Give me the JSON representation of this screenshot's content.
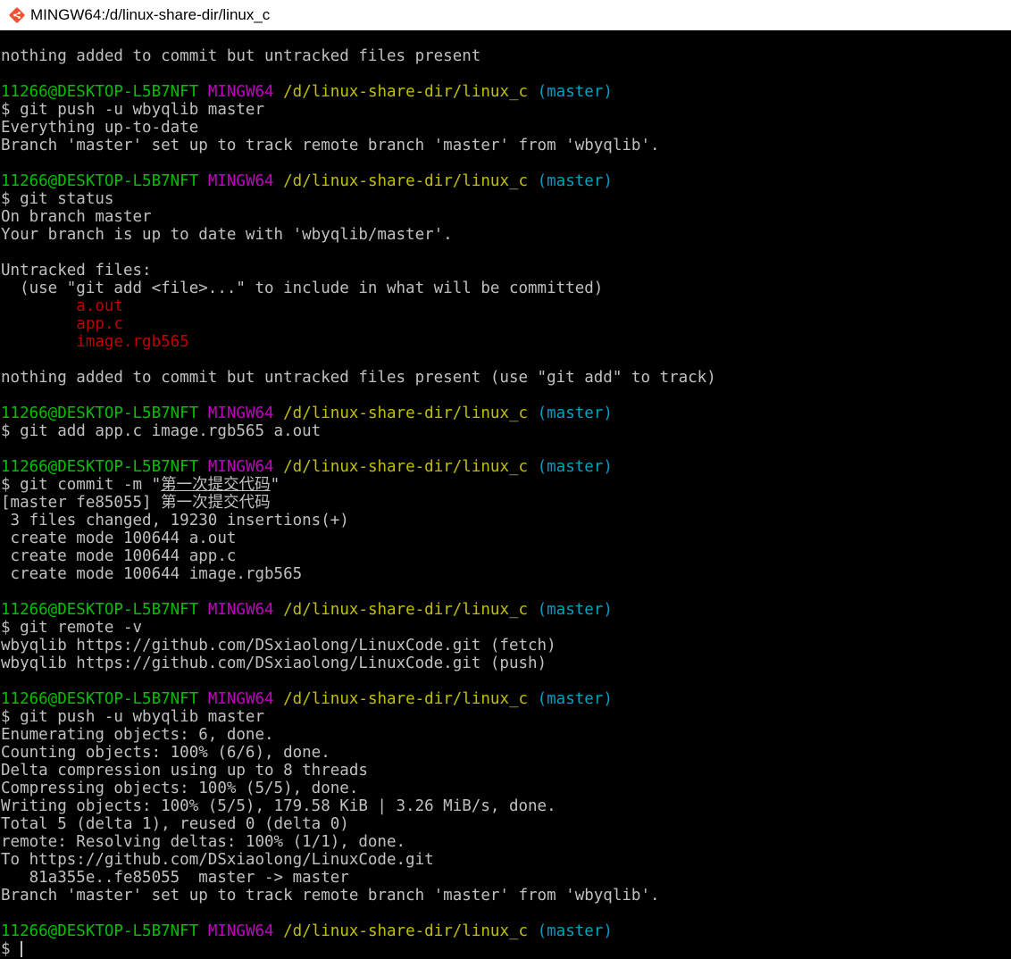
{
  "window": {
    "title": "MINGW64:/d/linux-share-dir/linux_c",
    "icon": "git-bash-icon"
  },
  "colors": {
    "background": "#000000",
    "default_text": "#c0c0c0",
    "user_host": "#00c000",
    "shell_name": "#c000c0",
    "path": "#c0c000",
    "branch": "#00a0c0",
    "untracked_file": "#c00000"
  },
  "terminal": {
    "lines": [
      {
        "segments": [
          {
            "text": "nothing added to commit but untracked files present"
          }
        ]
      },
      {
        "segments": []
      },
      {
        "segments": [
          {
            "text": "11266@DESKTOP-L5B7NFT",
            "color": "green"
          },
          {
            "text": " "
          },
          {
            "text": "MINGW64",
            "color": "magenta"
          },
          {
            "text": " "
          },
          {
            "text": "/d/linux-share-dir/linux_c",
            "color": "yellow"
          },
          {
            "text": " "
          },
          {
            "text": "(master)",
            "color": "cyan"
          }
        ]
      },
      {
        "segments": [
          {
            "text": "$ git push -u wbyqlib master"
          }
        ]
      },
      {
        "segments": [
          {
            "text": "Everything up-to-date"
          }
        ]
      },
      {
        "segments": [
          {
            "text": "Branch 'master' set up to track remote branch 'master' from 'wbyqlib'."
          }
        ]
      },
      {
        "segments": []
      },
      {
        "segments": [
          {
            "text": "11266@DESKTOP-L5B7NFT",
            "color": "green"
          },
          {
            "text": " "
          },
          {
            "text": "MINGW64",
            "color": "magenta"
          },
          {
            "text": " "
          },
          {
            "text": "/d/linux-share-dir/linux_c",
            "color": "yellow"
          },
          {
            "text": " "
          },
          {
            "text": "(master)",
            "color": "cyan"
          }
        ]
      },
      {
        "segments": [
          {
            "text": "$ git status"
          }
        ]
      },
      {
        "segments": [
          {
            "text": "On branch master"
          }
        ]
      },
      {
        "segments": [
          {
            "text": "Your branch is up to date with 'wbyqlib/master'."
          }
        ]
      },
      {
        "segments": []
      },
      {
        "segments": [
          {
            "text": "Untracked files:"
          }
        ]
      },
      {
        "segments": [
          {
            "text": "  (use \"git add <file>...\" to include in what will be committed)"
          }
        ]
      },
      {
        "segments": [
          {
            "text": "        "
          },
          {
            "text": "a.out",
            "color": "red"
          }
        ]
      },
      {
        "segments": [
          {
            "text": "        "
          },
          {
            "text": "app.c",
            "color": "red"
          }
        ]
      },
      {
        "segments": [
          {
            "text": "        "
          },
          {
            "text": "image.rgb565",
            "color": "red"
          }
        ]
      },
      {
        "segments": []
      },
      {
        "segments": [
          {
            "text": "nothing added to commit but untracked files present (use \"git add\" to track)"
          }
        ]
      },
      {
        "segments": []
      },
      {
        "segments": [
          {
            "text": "11266@DESKTOP-L5B7NFT",
            "color": "green"
          },
          {
            "text": " "
          },
          {
            "text": "MINGW64",
            "color": "magenta"
          },
          {
            "text": " "
          },
          {
            "text": "/d/linux-share-dir/linux_c",
            "color": "yellow"
          },
          {
            "text": " "
          },
          {
            "text": "(master)",
            "color": "cyan"
          }
        ]
      },
      {
        "segments": [
          {
            "text": "$ git add app.c image.rgb565 a.out"
          }
        ]
      },
      {
        "segments": []
      },
      {
        "segments": [
          {
            "text": "11266@DESKTOP-L5B7NFT",
            "color": "green"
          },
          {
            "text": " "
          },
          {
            "text": "MINGW64",
            "color": "magenta"
          },
          {
            "text": " "
          },
          {
            "text": "/d/linux-share-dir/linux_c",
            "color": "yellow"
          },
          {
            "text": " "
          },
          {
            "text": "(master)",
            "color": "cyan"
          }
        ]
      },
      {
        "segments": [
          {
            "text": "$ git commit -m \""
          },
          {
            "text": "第一次提交代码",
            "underline": true
          },
          {
            "text": "\""
          }
        ]
      },
      {
        "segments": [
          {
            "text": "[master fe85055] 第一次提交代码"
          }
        ]
      },
      {
        "segments": [
          {
            "text": " 3 files changed, 19230 insertions(+)"
          }
        ]
      },
      {
        "segments": [
          {
            "text": " create mode 100644 a.out"
          }
        ]
      },
      {
        "segments": [
          {
            "text": " create mode 100644 app.c"
          }
        ]
      },
      {
        "segments": [
          {
            "text": " create mode 100644 image.rgb565"
          }
        ]
      },
      {
        "segments": []
      },
      {
        "segments": [
          {
            "text": "11266@DESKTOP-L5B7NFT",
            "color": "green"
          },
          {
            "text": " "
          },
          {
            "text": "MINGW64",
            "color": "magenta"
          },
          {
            "text": " "
          },
          {
            "text": "/d/linux-share-dir/linux_c",
            "color": "yellow"
          },
          {
            "text": " "
          },
          {
            "text": "(master)",
            "color": "cyan"
          }
        ]
      },
      {
        "segments": [
          {
            "text": "$ git remote -v"
          }
        ]
      },
      {
        "segments": [
          {
            "text": "wbyqlib https://github.com/DSxiaolong/LinuxCode.git (fetch)"
          }
        ]
      },
      {
        "segments": [
          {
            "text": "wbyqlib https://github.com/DSxiaolong/LinuxCode.git (push)"
          }
        ]
      },
      {
        "segments": []
      },
      {
        "segments": [
          {
            "text": "11266@DESKTOP-L5B7NFT",
            "color": "green"
          },
          {
            "text": " "
          },
          {
            "text": "MINGW64",
            "color": "magenta"
          },
          {
            "text": " "
          },
          {
            "text": "/d/linux-share-dir/linux_c",
            "color": "yellow"
          },
          {
            "text": " "
          },
          {
            "text": "(master)",
            "color": "cyan"
          }
        ]
      },
      {
        "segments": [
          {
            "text": "$ git push -u wbyqlib master"
          }
        ]
      },
      {
        "segments": [
          {
            "text": "Enumerating objects: 6, done."
          }
        ]
      },
      {
        "segments": [
          {
            "text": "Counting objects: 100% (6/6), done."
          }
        ]
      },
      {
        "segments": [
          {
            "text": "Delta compression using up to 8 threads"
          }
        ]
      },
      {
        "segments": [
          {
            "text": "Compressing objects: 100% (5/5), done."
          }
        ]
      },
      {
        "segments": [
          {
            "text": "Writing objects: 100% (5/5), 179.58 KiB | 3.26 MiB/s, done."
          }
        ]
      },
      {
        "segments": [
          {
            "text": "Total 5 (delta 1), reused 0 (delta 0)"
          }
        ]
      },
      {
        "segments": [
          {
            "text": "remote: Resolving deltas: 100% (1/1), done."
          }
        ]
      },
      {
        "segments": [
          {
            "text": "To https://github.com/DSxiaolong/LinuxCode.git"
          }
        ]
      },
      {
        "segments": [
          {
            "text": "   81a355e..fe85055  master -> master"
          }
        ]
      },
      {
        "segments": [
          {
            "text": "Branch 'master' set up to track remote branch 'master' from 'wbyqlib'."
          }
        ]
      },
      {
        "segments": []
      },
      {
        "segments": [
          {
            "text": "11266@DESKTOP-L5B7NFT",
            "color": "green"
          },
          {
            "text": " "
          },
          {
            "text": "MINGW64",
            "color": "magenta"
          },
          {
            "text": " "
          },
          {
            "text": "/d/linux-share-dir/linux_c",
            "color": "yellow"
          },
          {
            "text": " "
          },
          {
            "text": "(master)",
            "color": "cyan"
          }
        ]
      },
      {
        "segments": [
          {
            "text": "$ "
          }
        ],
        "cursor": true
      }
    ]
  }
}
